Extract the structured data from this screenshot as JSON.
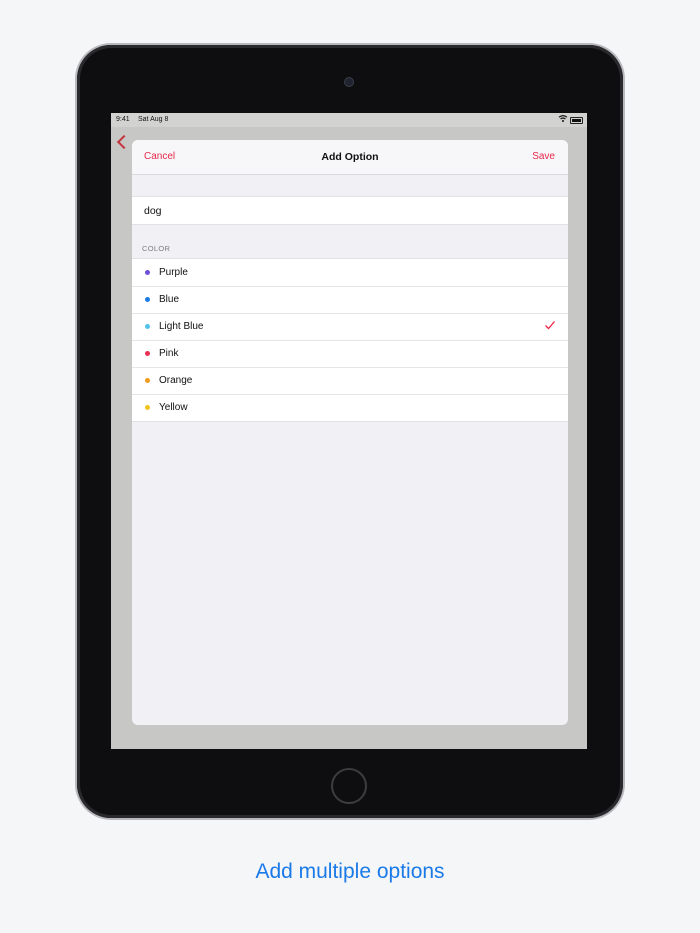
{
  "status_bar": {
    "time": "9:41",
    "date": "Sat Aug 8"
  },
  "modal": {
    "nav": {
      "cancel_label": "Cancel",
      "title": "Add Option",
      "save_label": "Save"
    },
    "name_field": {
      "value": "dog"
    },
    "color_section": {
      "header": "COLOR",
      "items": [
        {
          "label": "Purple",
          "color": "#6e4fd6",
          "selected": false
        },
        {
          "label": "Blue",
          "color": "#1a7ae8",
          "selected": false
        },
        {
          "label": "Light Blue",
          "color": "#52c2ea",
          "selected": true
        },
        {
          "label": "Pink",
          "color": "#ea2f50",
          "selected": false
        },
        {
          "label": "Orange",
          "color": "#f19a1e",
          "selected": false
        },
        {
          "label": "Yellow",
          "color": "#f2c31a",
          "selected": false
        }
      ]
    },
    "accent_color": "#e8274a"
  },
  "caption": "Add multiple options"
}
